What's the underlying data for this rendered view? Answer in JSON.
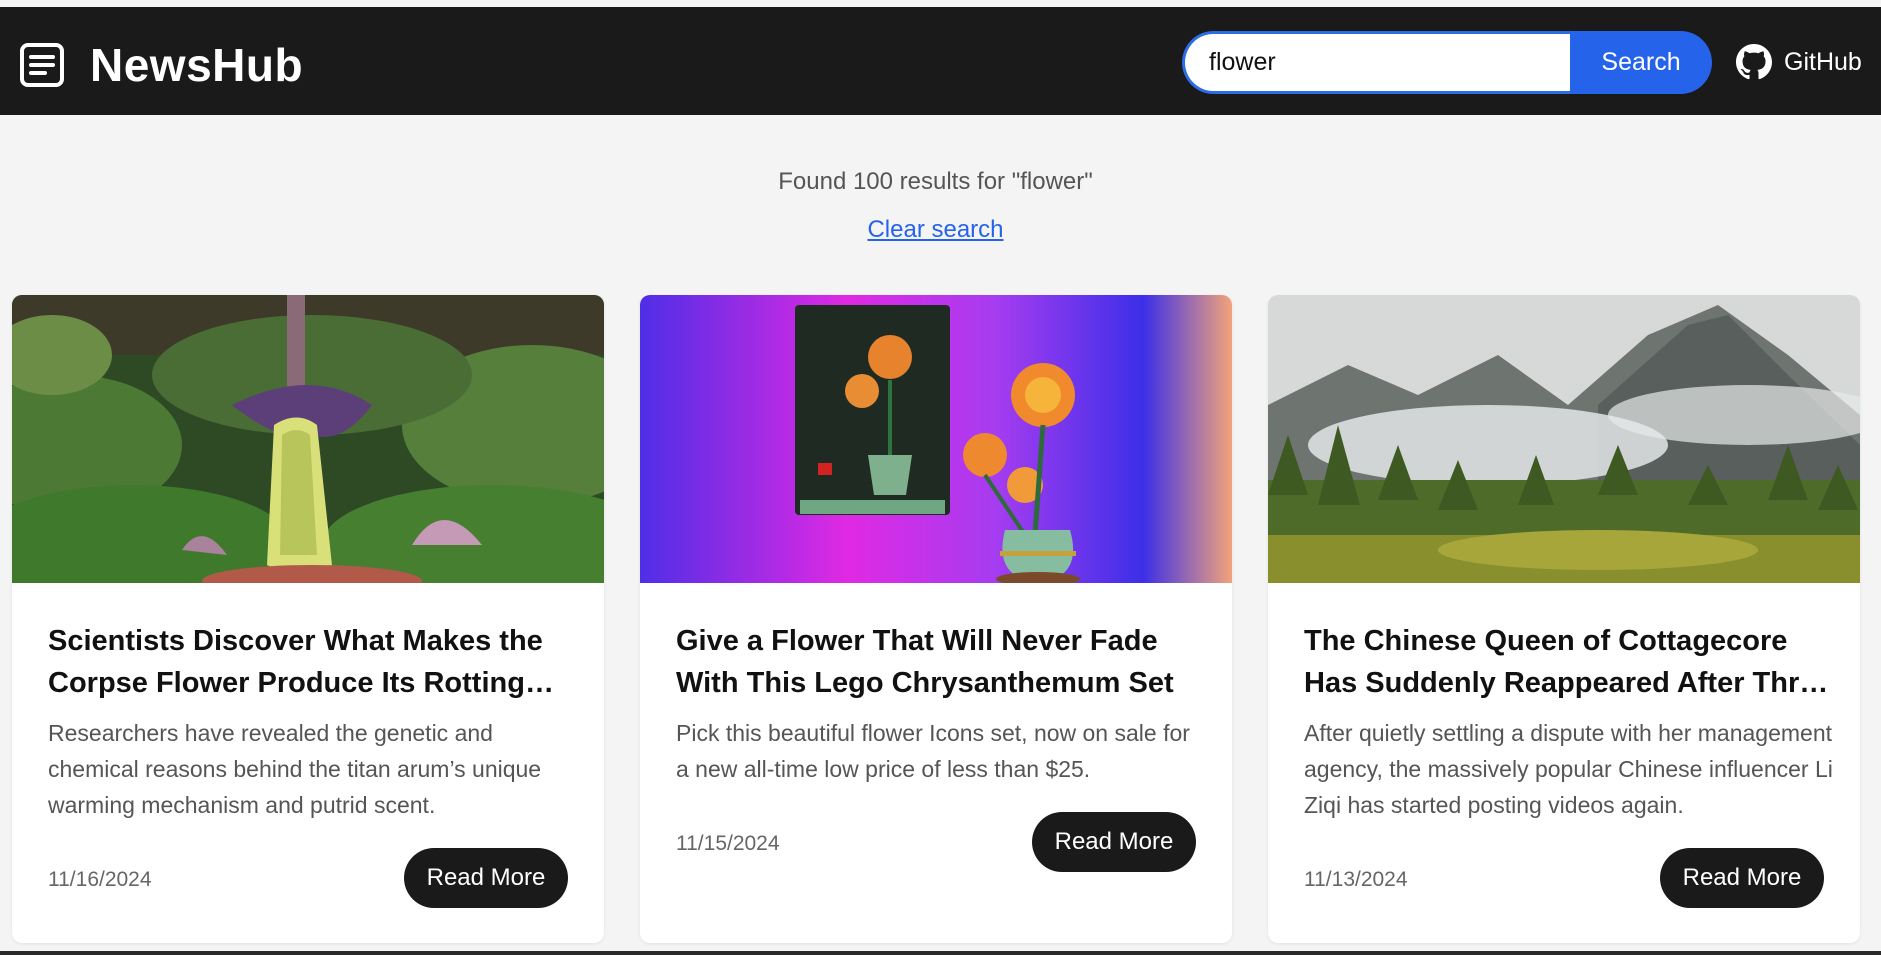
{
  "header": {
    "brand": "NewsHub",
    "search_value": "flower",
    "search_button": "Search",
    "github_label": "GitHub"
  },
  "results": {
    "summary": "Found 100 results for \"flower\"",
    "clear_label": "Clear search"
  },
  "cards": [
    {
      "title": "Scientists Discover What Makes the Corpse Flower Produce Its Rotting Smell",
      "description": "Researchers have revealed the genetic and chemical reasons behind the titan arum’s unique warming mechanism and putrid scent.",
      "date": "11/16/2024",
      "button": "Read More"
    },
    {
      "title": "Give a Flower That Will Never Fade With This Lego Chrysanthemum Set",
      "description": "Pick this beautiful flower Icons set, now on sale for a new all-time low price of less than $25.",
      "date": "11/15/2024",
      "button": "Read More"
    },
    {
      "title": "The Chinese Queen of Cottagecore Has Suddenly Reappeared After Three Years",
      "description": "After quietly settling a dispute with her management agency, the massively popular Chinese influencer Li Ziqi has started posting videos again.",
      "date": "11/13/2024",
      "button": "Read More"
    }
  ],
  "colors": {
    "header_bg": "#1a1a1a",
    "accent": "#2563eb",
    "page_bg": "#f4f4f4",
    "button_dark": "#1a1a1a"
  }
}
